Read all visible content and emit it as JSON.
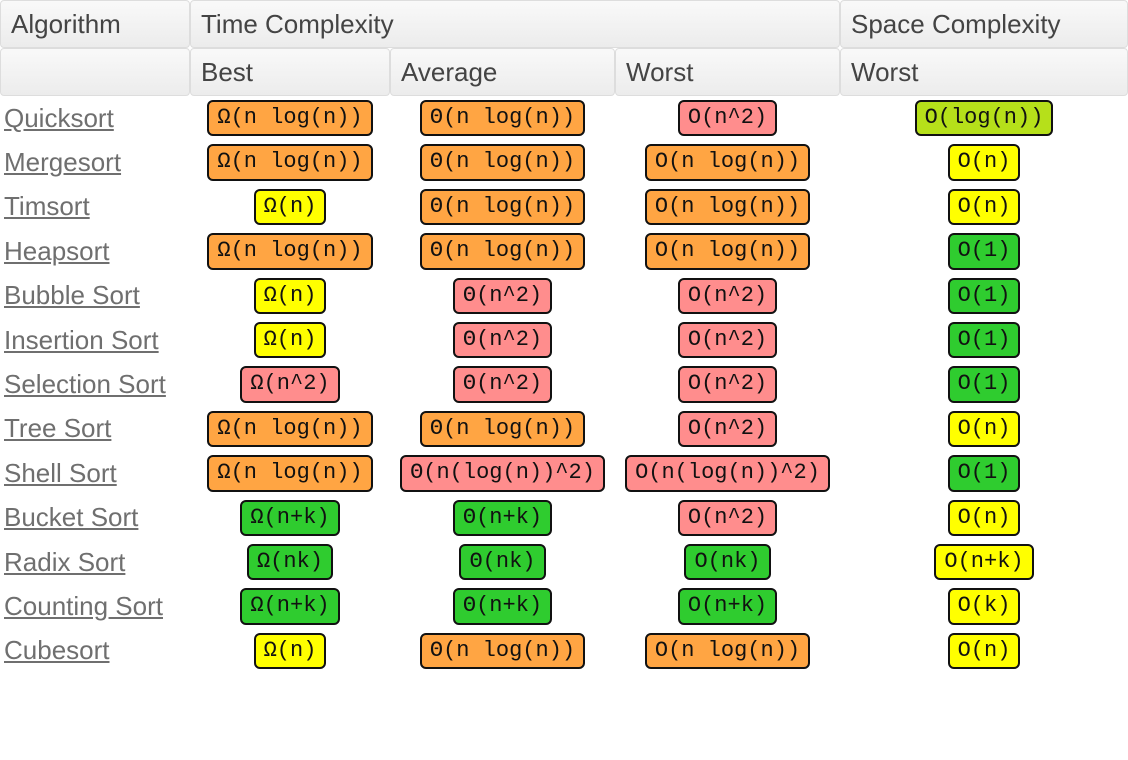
{
  "headers": {
    "algorithm": "Algorithm",
    "time": "Time Complexity",
    "space": "Space Complexity",
    "best": "Best",
    "average": "Average",
    "worst": "Worst",
    "space_worst": "Worst"
  },
  "colors": {
    "green": "#2fcc2f",
    "yellowgreen": "#b6e01a",
    "yellow": "#ffff00",
    "orange": "#ffa543",
    "red": "#ff8d8d"
  },
  "rows": [
    {
      "name": "Quicksort",
      "best": {
        "text": "Ω(n log(n))",
        "level": "orange"
      },
      "avg": {
        "text": "Θ(n log(n))",
        "level": "orange"
      },
      "worst": {
        "text": "O(n^2)",
        "level": "red"
      },
      "space": {
        "text": "O(log(n))",
        "level": "yellowgreen"
      }
    },
    {
      "name": "Mergesort",
      "best": {
        "text": "Ω(n log(n))",
        "level": "orange"
      },
      "avg": {
        "text": "Θ(n log(n))",
        "level": "orange"
      },
      "worst": {
        "text": "O(n log(n))",
        "level": "orange"
      },
      "space": {
        "text": "O(n)",
        "level": "yellow"
      }
    },
    {
      "name": "Timsort",
      "best": {
        "text": "Ω(n)",
        "level": "yellow"
      },
      "avg": {
        "text": "Θ(n log(n))",
        "level": "orange"
      },
      "worst": {
        "text": "O(n log(n))",
        "level": "orange"
      },
      "space": {
        "text": "O(n)",
        "level": "yellow"
      }
    },
    {
      "name": "Heapsort",
      "best": {
        "text": "Ω(n log(n))",
        "level": "orange"
      },
      "avg": {
        "text": "Θ(n log(n))",
        "level": "orange"
      },
      "worst": {
        "text": "O(n log(n))",
        "level": "orange"
      },
      "space": {
        "text": "O(1)",
        "level": "green"
      }
    },
    {
      "name": "Bubble Sort",
      "best": {
        "text": "Ω(n)",
        "level": "yellow"
      },
      "avg": {
        "text": "Θ(n^2)",
        "level": "red"
      },
      "worst": {
        "text": "O(n^2)",
        "level": "red"
      },
      "space": {
        "text": "O(1)",
        "level": "green"
      }
    },
    {
      "name": "Insertion Sort",
      "best": {
        "text": "Ω(n)",
        "level": "yellow"
      },
      "avg": {
        "text": "Θ(n^2)",
        "level": "red"
      },
      "worst": {
        "text": "O(n^2)",
        "level": "red"
      },
      "space": {
        "text": "O(1)",
        "level": "green"
      }
    },
    {
      "name": "Selection Sort",
      "best": {
        "text": "Ω(n^2)",
        "level": "red"
      },
      "avg": {
        "text": "Θ(n^2)",
        "level": "red"
      },
      "worst": {
        "text": "O(n^2)",
        "level": "red"
      },
      "space": {
        "text": "O(1)",
        "level": "green"
      }
    },
    {
      "name": "Tree Sort",
      "best": {
        "text": "Ω(n log(n))",
        "level": "orange"
      },
      "avg": {
        "text": "Θ(n log(n))",
        "level": "orange"
      },
      "worst": {
        "text": "O(n^2)",
        "level": "red"
      },
      "space": {
        "text": "O(n)",
        "level": "yellow"
      }
    },
    {
      "name": "Shell Sort",
      "best": {
        "text": "Ω(n log(n))",
        "level": "orange"
      },
      "avg": {
        "text": "Θ(n(log(n))^2)",
        "level": "red"
      },
      "worst": {
        "text": "O(n(log(n))^2)",
        "level": "red"
      },
      "space": {
        "text": "O(1)",
        "level": "green"
      }
    },
    {
      "name": "Bucket Sort",
      "best": {
        "text": "Ω(n+k)",
        "level": "green"
      },
      "avg": {
        "text": "Θ(n+k)",
        "level": "green"
      },
      "worst": {
        "text": "O(n^2)",
        "level": "red"
      },
      "space": {
        "text": "O(n)",
        "level": "yellow"
      }
    },
    {
      "name": "Radix Sort",
      "best": {
        "text": "Ω(nk)",
        "level": "green"
      },
      "avg": {
        "text": "Θ(nk)",
        "level": "green"
      },
      "worst": {
        "text": "O(nk)",
        "level": "green"
      },
      "space": {
        "text": "O(n+k)",
        "level": "yellow"
      }
    },
    {
      "name": "Counting Sort",
      "best": {
        "text": "Ω(n+k)",
        "level": "green"
      },
      "avg": {
        "text": "Θ(n+k)",
        "level": "green"
      },
      "worst": {
        "text": "O(n+k)",
        "level": "green"
      },
      "space": {
        "text": "O(k)",
        "level": "yellow"
      }
    },
    {
      "name": "Cubesort",
      "best": {
        "text": "Ω(n)",
        "level": "yellow"
      },
      "avg": {
        "text": "Θ(n log(n))",
        "level": "orange"
      },
      "worst": {
        "text": "O(n log(n))",
        "level": "orange"
      },
      "space": {
        "text": "O(n)",
        "level": "yellow"
      }
    }
  ]
}
